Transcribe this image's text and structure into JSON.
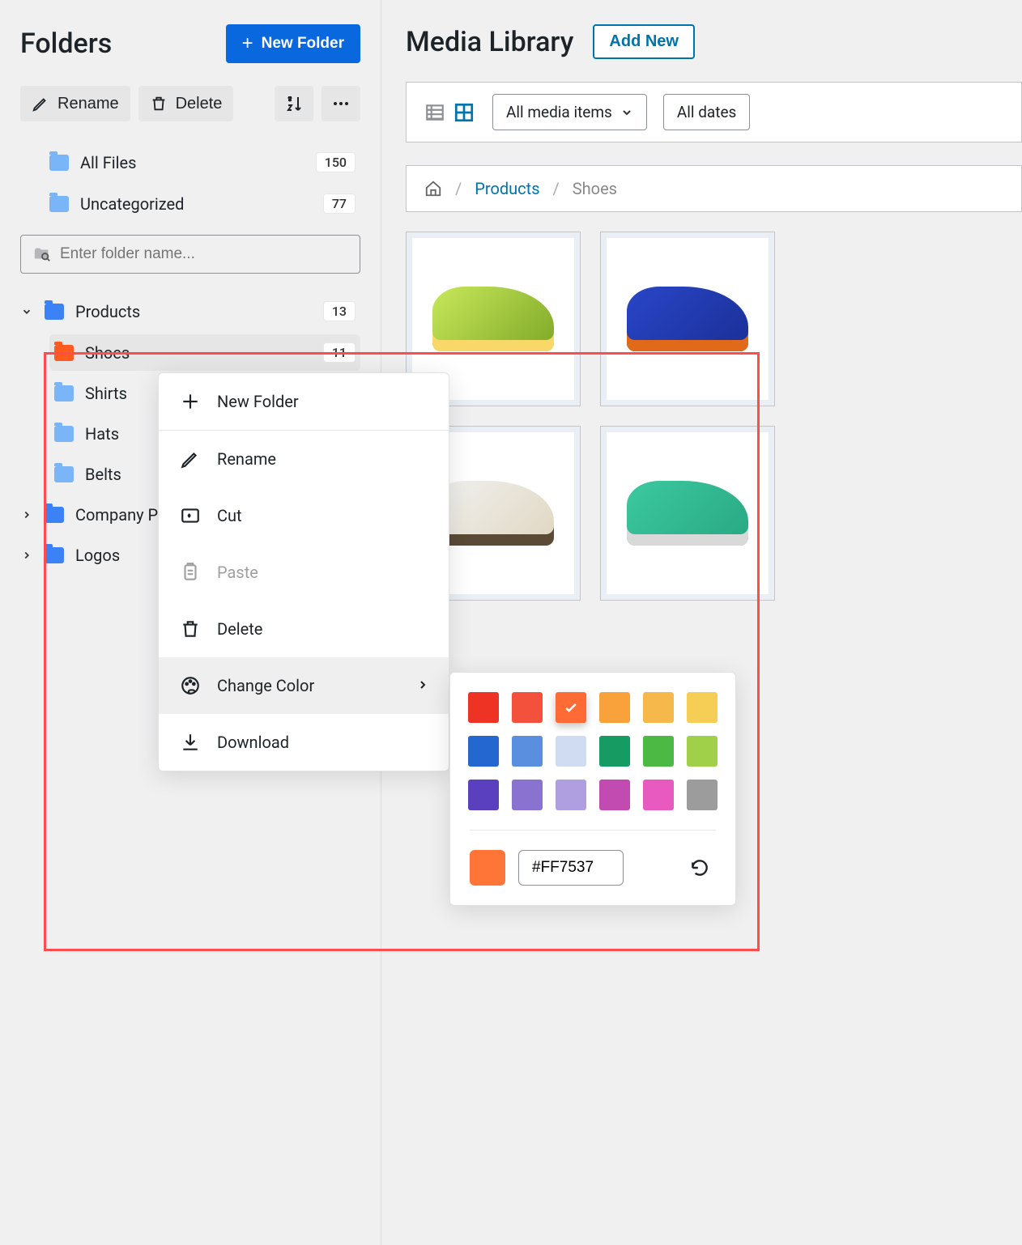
{
  "sidebar": {
    "title": "Folders",
    "new_folder_btn": "New Folder",
    "toolbar": {
      "rename": "Rename",
      "delete": "Delete"
    },
    "all_files": {
      "label": "All Files",
      "count": "150"
    },
    "uncategorized": {
      "label": "Uncategorized",
      "count": "77"
    },
    "search_placeholder": "Enter folder name...",
    "tree": {
      "products": {
        "label": "Products",
        "count": "13"
      },
      "shoes": {
        "label": "Shoes",
        "count": "11"
      },
      "shirts": {
        "label": "Shirts"
      },
      "hats": {
        "label": "Hats"
      },
      "belts": {
        "label": "Belts"
      },
      "company": {
        "label": "Company Policies"
      },
      "logos": {
        "label": "Logos"
      }
    }
  },
  "main": {
    "title": "Media Library",
    "add_new": "Add New",
    "filter_media": "All media items",
    "filter_dates": "All dates",
    "breadcrumb": {
      "products": "Products",
      "shoes": "Shoes"
    }
  },
  "context_menu": {
    "new_folder": "New Folder",
    "rename": "Rename",
    "cut": "Cut",
    "paste": "Paste",
    "delete": "Delete",
    "change_color": "Change Color",
    "download": "Download"
  },
  "color_picker": {
    "colors": [
      "#ee3224",
      "#f4513c",
      "#ff6a35",
      "#f9a13a",
      "#f7b84b",
      "#f6ce55",
      "#2467d1",
      "#5a8fe0",
      "#cfdcf2",
      "#169b62",
      "#4cb944",
      "#a0d049",
      "#5a3fbf",
      "#8a72d0",
      "#b09fe0",
      "#c24bb2",
      "#e85ac0",
      "#9c9c9c"
    ],
    "selected_color": "#FF7537",
    "selected_index": 2
  }
}
